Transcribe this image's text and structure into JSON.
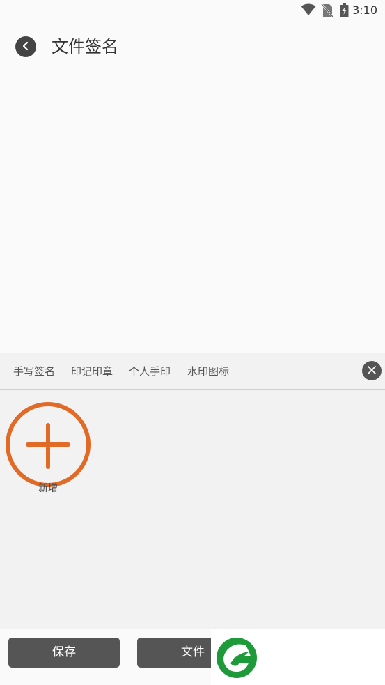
{
  "status_bar": {
    "time": "3:10",
    "icons": [
      "wifi-icon",
      "no-sim-icon",
      "battery-charging-icon"
    ]
  },
  "header": {
    "back_icon": "chevron-left-icon",
    "title": "文件签名"
  },
  "panel": {
    "tabs": [
      {
        "label": "手写签名"
      },
      {
        "label": "印记印章"
      },
      {
        "label": "个人手印"
      },
      {
        "label": "水印图标"
      }
    ],
    "close_icon": "close-icon",
    "add_tile": {
      "icon": "plus-circle-icon",
      "label": "新增",
      "accent": "#e06a26"
    }
  },
  "actions": {
    "save_label": "保存",
    "file_label": "文件"
  },
  "colors": {
    "accent": "#e06a26",
    "button_bg": "#555555",
    "logo_green": "#1f9a3a"
  }
}
